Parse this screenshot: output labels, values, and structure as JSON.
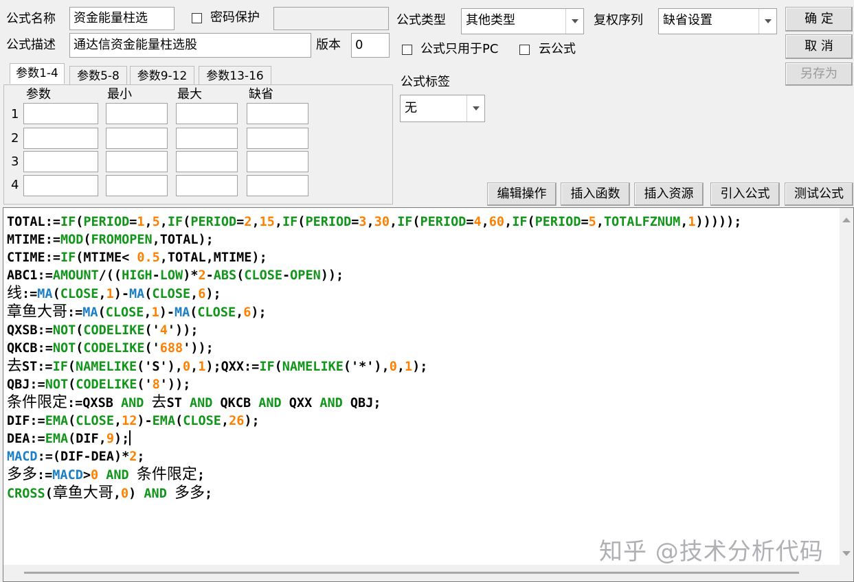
{
  "header": {
    "formula_name_label": "公式名称",
    "formula_name_value": "资金能量柱选",
    "password_label": "密码保护",
    "formula_desc_label": "公式描述",
    "formula_desc_value": "通达信资金能量柱选股",
    "version_label": "版本",
    "version_value": "0",
    "formula_type_label": "公式类型",
    "formula_type_value": "其他类型",
    "rights_label": "复权序列",
    "rights_value": "缺省设置",
    "pc_only_label": "公式只用于PC",
    "cloud_label": "云公式",
    "tag_label": "公式标签",
    "tag_value": "无"
  },
  "buttons": {
    "ok": "确  定",
    "cancel": "取  消",
    "save_as": "另存为",
    "edit_ops": "编辑操作",
    "insert_func": "插入函数",
    "insert_res": "插入资源",
    "import_formula": "引入公式",
    "test_formula": "测试公式"
  },
  "tabs": [
    "参数1-4",
    "参数5-8",
    "参数9-12",
    "参数13-16"
  ],
  "params": {
    "headers": [
      "参数",
      "最小",
      "最大",
      "缺省"
    ],
    "rows": [
      "1",
      "2",
      "3",
      "4"
    ]
  },
  "code_lines": [
    "TOTAL:=IF(PERIOD=1,5,IF(PERIOD=2,15,IF(PERIOD=3,30,IF(PERIOD=4,60,IF(PERIOD=5,TOTALFZNUM,1)))));",
    "MTIME:=MOD(FROMOPEN,TOTAL);",
    "CTIME:=IF(MTIME< 0.5,TOTAL,MTIME);",
    "ABC1:=AMOUNT/((HIGH-LOW)*2-ABS(CLOSE-OPEN));",
    "线:=MA(CLOSE,1)-MA(CLOSE,6);",
    "章鱼大哥:=MA(CLOSE,1)-MA(CLOSE,6);",
    "QXSB:=NOT(CODELIKE('4'));",
    "QKCB:=NOT(CODELIKE('688'));",
    "去ST:=IF(NAMELIKE('S'),0,1);QXX:=IF(NAMELIKE('*'),0,1);",
    "QBJ:=NOT(CODELIKE('8'));",
    "条件限定:=QXSB AND 去ST AND QKCB AND QXX AND QBJ;",
    "DIF:=EMA(CLOSE,12)-EMA(CLOSE,26);",
    "DEA:=EMA(DIF,9);",
    "MACD:=(DIF-DEA)*2;",
    "多多:=MACD>0 AND 条件限定;",
    "CROSS(章鱼大哥,0) AND 多多;"
  ],
  "watermark": "知乎 @技术分析代码",
  "colors": {
    "function": "#11961a",
    "macd": "#1b7fc7",
    "number": "#ff8000"
  }
}
